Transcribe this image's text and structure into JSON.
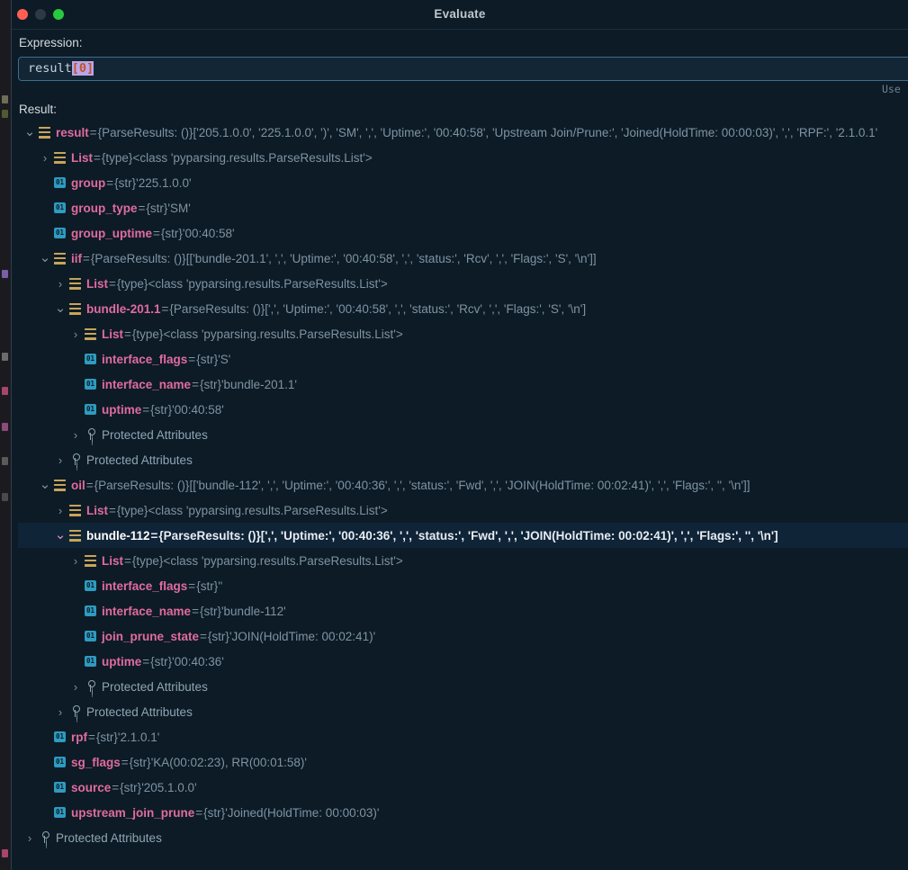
{
  "window": {
    "title": "Evaluate",
    "traffic_lights": [
      "close-red",
      "minimize-amber",
      "zoom-green"
    ]
  },
  "expression": {
    "label": "Expression:",
    "value_prefix": "result",
    "value_selected": "[0]",
    "full_value": "result[0]",
    "hint": "Use"
  },
  "result": {
    "label": "Result:"
  },
  "icons": {
    "object": "object-icon",
    "string": "string-icon",
    "protected": "key-icon",
    "expanded": "⌄",
    "collapsed": "›"
  },
  "colors": {
    "background": "#0d1b26",
    "selection": "#102437",
    "name": "#e06c9f",
    "value": "#7e93a2",
    "object_icon": "#c8a45a",
    "string_icon": "#2e9bc0",
    "input_border": "#3d6e8f"
  },
  "tree": [
    {
      "indent": 0,
      "toggle": "expanded",
      "icon": "object",
      "name": "result",
      "eq": "=",
      "type": "{ParseResults: ()}",
      "value": "['205.1.0.0', '225.1.0.0', ')', 'SM', ',', 'Uptime:', '00:40:58', 'Upstream Join/Prune:', 'Joined(HoldTime: 00:00:03)', ',', 'RPF:', '2.1.0.1'",
      "selected": false
    },
    {
      "indent": 1,
      "toggle": "collapsed",
      "icon": "object",
      "name": "List",
      "eq": "=",
      "type": "{type}",
      "value": "<class 'pyparsing.results.ParseResults.List'>",
      "selected": false
    },
    {
      "indent": 1,
      "toggle": "none",
      "icon": "string",
      "name": "group",
      "eq": "=",
      "type": "{str}",
      "value": "'225.1.0.0'",
      "selected": false
    },
    {
      "indent": 1,
      "toggle": "none",
      "icon": "string",
      "name": "group_type",
      "eq": "=",
      "type": "{str}",
      "value": "'SM'",
      "selected": false
    },
    {
      "indent": 1,
      "toggle": "none",
      "icon": "string",
      "name": "group_uptime",
      "eq": "=",
      "type": "{str}",
      "value": "'00:40:58'",
      "selected": false
    },
    {
      "indent": 1,
      "toggle": "expanded",
      "icon": "object",
      "name": "iif",
      "eq": "=",
      "type": "{ParseResults: ()}",
      "value": "[['bundle-201.1', ',', 'Uptime:', '00:40:58', ',', 'status:', 'Rcv', ',', 'Flags:', 'S', '\\n']]",
      "selected": false
    },
    {
      "indent": 2,
      "toggle": "collapsed",
      "icon": "object",
      "name": "List",
      "eq": "=",
      "type": "{type}",
      "value": "<class 'pyparsing.results.ParseResults.List'>",
      "selected": false
    },
    {
      "indent": 2,
      "toggle": "expanded",
      "icon": "object",
      "name": "bundle-201.1",
      "eq": "=",
      "type": "{ParseResults: ()}",
      "value": "[',', 'Uptime:', '00:40:58', ',', 'status:', 'Rcv', ',', 'Flags:', 'S', '\\n']",
      "selected": false
    },
    {
      "indent": 3,
      "toggle": "collapsed",
      "icon": "object",
      "name": "List",
      "eq": "=",
      "type": "{type}",
      "value": "<class 'pyparsing.results.ParseResults.List'>",
      "selected": false
    },
    {
      "indent": 3,
      "toggle": "none",
      "icon": "string",
      "name": "interface_flags",
      "eq": "=",
      "type": "{str}",
      "value": "'S'",
      "selected": false
    },
    {
      "indent": 3,
      "toggle": "none",
      "icon": "string",
      "name": "interface_name",
      "eq": "=",
      "type": "{str}",
      "value": "'bundle-201.1'",
      "selected": false
    },
    {
      "indent": 3,
      "toggle": "none",
      "icon": "string",
      "name": "uptime",
      "eq": "=",
      "type": "{str}",
      "value": "'00:40:58'",
      "selected": false
    },
    {
      "indent": 3,
      "toggle": "collapsed",
      "icon": "protected",
      "name": "",
      "eq": "",
      "type": "",
      "value": "Protected Attributes",
      "plain": true,
      "selected": false
    },
    {
      "indent": 2,
      "toggle": "collapsed",
      "icon": "protected",
      "name": "",
      "eq": "",
      "type": "",
      "value": "Protected Attributes",
      "plain": true,
      "selected": false
    },
    {
      "indent": 1,
      "toggle": "expanded",
      "icon": "object",
      "name": "oil",
      "eq": "=",
      "type": "{ParseResults: ()}",
      "value": "[['bundle-112', ',', 'Uptime:', '00:40:36', ',', 'status:', 'Fwd', ',', 'JOIN(HoldTime: 00:02:41)', ',', 'Flags:', '', '\\n']]",
      "selected": false
    },
    {
      "indent": 2,
      "toggle": "collapsed",
      "icon": "object",
      "name": "List",
      "eq": "=",
      "type": "{type}",
      "value": "<class 'pyparsing.results.ParseResults.List'>",
      "selected": false
    },
    {
      "indent": 2,
      "toggle": "expanded",
      "icon": "object",
      "name": "bundle-112",
      "eq": "=",
      "type": "{ParseResults: ()}",
      "value": "[',', 'Uptime:', '00:40:36', ',', 'status:', 'Fwd', ',', 'JOIN(HoldTime: 00:02:41)', ',', 'Flags:', '', '\\n']",
      "selected": true
    },
    {
      "indent": 3,
      "toggle": "collapsed",
      "icon": "object",
      "name": "List",
      "eq": "=",
      "type": "{type}",
      "value": "<class 'pyparsing.results.ParseResults.List'>",
      "selected": false
    },
    {
      "indent": 3,
      "toggle": "none",
      "icon": "string",
      "name": "interface_flags",
      "eq": "=",
      "type": "{str}",
      "value": "''",
      "selected": false
    },
    {
      "indent": 3,
      "toggle": "none",
      "icon": "string",
      "name": "interface_name",
      "eq": "=",
      "type": "{str}",
      "value": "'bundle-112'",
      "selected": false
    },
    {
      "indent": 3,
      "toggle": "none",
      "icon": "string",
      "name": "join_prune_state",
      "eq": "=",
      "type": "{str}",
      "value": "'JOIN(HoldTime: 00:02:41)'",
      "selected": false
    },
    {
      "indent": 3,
      "toggle": "none",
      "icon": "string",
      "name": "uptime",
      "eq": "=",
      "type": "{str}",
      "value": "'00:40:36'",
      "selected": false
    },
    {
      "indent": 3,
      "toggle": "collapsed",
      "icon": "protected",
      "name": "",
      "eq": "",
      "type": "",
      "value": "Protected Attributes",
      "plain": true,
      "selected": false
    },
    {
      "indent": 2,
      "toggle": "collapsed",
      "icon": "protected",
      "name": "",
      "eq": "",
      "type": "",
      "value": "Protected Attributes",
      "plain": true,
      "selected": false
    },
    {
      "indent": 1,
      "toggle": "none",
      "icon": "string",
      "name": "rpf",
      "eq": "=",
      "type": "{str}",
      "value": "'2.1.0.1'",
      "selected": false
    },
    {
      "indent": 1,
      "toggle": "none",
      "icon": "string",
      "name": "sg_flags",
      "eq": "=",
      "type": "{str}",
      "value": "'KA(00:02:23), RR(00:01:58)'",
      "selected": false
    },
    {
      "indent": 1,
      "toggle": "none",
      "icon": "string",
      "name": "source",
      "eq": "=",
      "type": "{str}",
      "value": "'205.1.0.0'",
      "selected": false
    },
    {
      "indent": 1,
      "toggle": "none",
      "icon": "string",
      "name": "upstream_join_prune",
      "eq": "=",
      "type": "{str}",
      "value": "'Joined(HoldTime: 00:00:03)'",
      "selected": false
    },
    {
      "indent": 0,
      "toggle": "collapsed",
      "icon": "protected",
      "name": "",
      "eq": "",
      "type": "",
      "value": "Protected Attributes",
      "plain": true,
      "selected": false
    }
  ]
}
